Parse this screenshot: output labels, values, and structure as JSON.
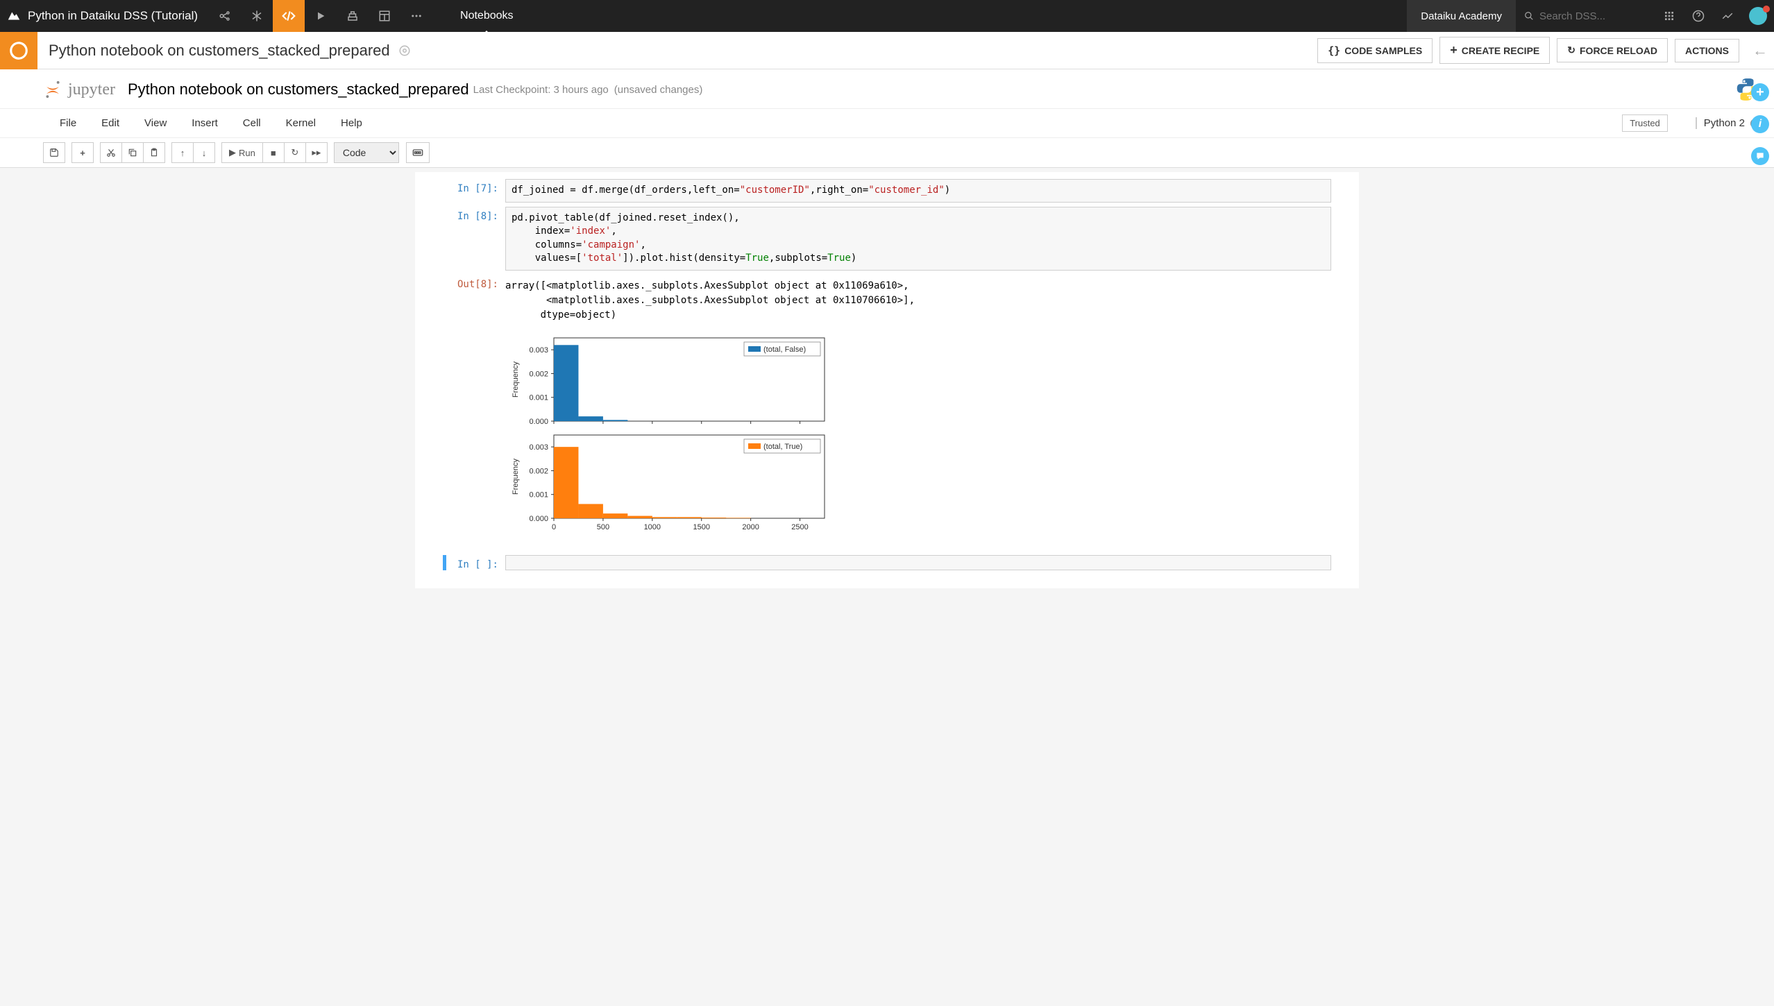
{
  "navbar": {
    "title": "Python in Dataiku DSS (Tutorial)",
    "tab_notebooks": "Notebooks",
    "academy": "Dataiku Academy",
    "search_placeholder": "Search DSS..."
  },
  "secondbar": {
    "title": "Python notebook on customers_stacked_prepared",
    "code_samples": "CODE SAMPLES",
    "create_recipe": "CREATE RECIPE",
    "force_reload": "FORCE RELOAD",
    "actions": "ACTIONS"
  },
  "jupyter": {
    "logo": "jupyter",
    "nbname": "Python notebook on customers_stacked_prepared",
    "checkpoint": "Last Checkpoint: 3 hours ago",
    "unsaved": "(unsaved changes)",
    "menus": [
      "File",
      "Edit",
      "View",
      "Insert",
      "Cell",
      "Kernel",
      "Help"
    ],
    "trusted": "Trusted",
    "kernel": "Python 2",
    "run_label": "Run",
    "celltype": "Code"
  },
  "cells": {
    "in7_prompt": "In [7]:",
    "in8_prompt": "In [8]:",
    "out8_prompt": "Out[8]:",
    "empty_prompt": "In [ ]:",
    "in7_html": "df_joined = df.merge(df_orders,left_on=<span class='str'>\"customerID\"</span>,right_on=<span class='str'>\"customer_id\"</span>)",
    "in8_html": "pd.pivot_table(df_joined.reset_index(),\n    index=<span class='str'>'index'</span>,\n    columns=<span class='str'>'campaign'</span>,\n    values=[<span class='str'>'total'</span>]).plot.hist(density=<span class='val'>True</span>,subplots=<span class='val'>True</span>)",
    "out8_text": "array([<matplotlib.axes._subplots.AxesSubplot object at 0x11069a610>,\n       <matplotlib.axes._subplots.AxesSubplot object at 0x110706610>],\n      dtype=object)"
  },
  "chart_data": [
    {
      "type": "bar",
      "ylabel": "Frequency",
      "yticks": [
        0.0,
        0.001,
        0.002,
        0.003
      ],
      "legend": "(total, False)",
      "color": "#1f77b4",
      "bins_x": [
        0,
        250,
        500,
        750,
        1000,
        1250,
        1500,
        1750,
        2000,
        2250,
        2500
      ],
      "values": [
        0.0032,
        0.0002,
        5e-05,
        0,
        0,
        0,
        0,
        0,
        0,
        0
      ]
    },
    {
      "type": "bar",
      "ylabel": "Frequency",
      "yticks": [
        0.0,
        0.001,
        0.002,
        0.003
      ],
      "xticks": [
        0,
        500,
        1000,
        1500,
        2000,
        2500
      ],
      "legend": "(total, True)",
      "color": "#ff7f0e",
      "bins_x": [
        0,
        250,
        500,
        750,
        1000,
        1250,
        1500,
        1750,
        2000,
        2250,
        2500
      ],
      "values": [
        0.003,
        0.0006,
        0.0002,
        0.0001,
        5e-05,
        5e-05,
        3e-05,
        2e-05,
        0,
        0
      ]
    }
  ]
}
